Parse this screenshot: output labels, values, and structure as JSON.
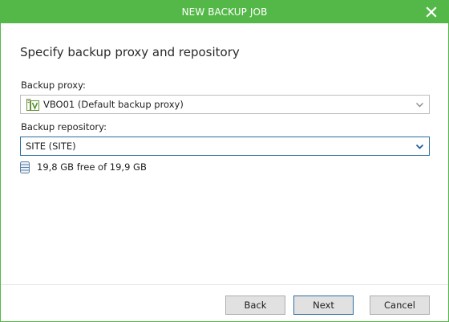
{
  "window": {
    "title": "NEW BACKUP JOB",
    "accent_color": "#54b848",
    "close_icon": "close-icon"
  },
  "page": {
    "heading": "Specify backup proxy and repository"
  },
  "proxy": {
    "label": "Backup proxy:",
    "selected": "VBO01 (Default backup proxy)",
    "icon": "proxy-server-icon"
  },
  "repository": {
    "label": "Backup repository:",
    "selected": "SITE (SITE)",
    "free_space": "19,8 GB free of 19,9 GB",
    "icon": "database-icon"
  },
  "buttons": {
    "back": "Back",
    "next": "Next",
    "cancel": "Cancel"
  }
}
